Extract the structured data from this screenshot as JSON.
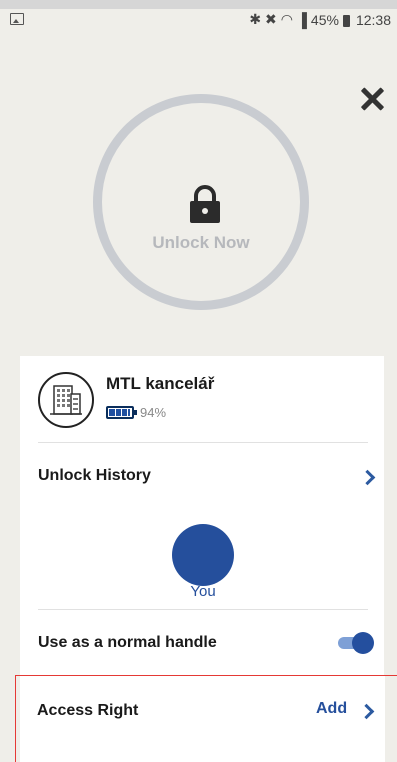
{
  "status_bar": {
    "battery_percent": "45%",
    "time": "12:38",
    "icons": [
      "bluetooth-icon",
      "mute-icon",
      "wifi-icon",
      "signal-icon",
      "battery-icon"
    ]
  },
  "unlock": {
    "label": "Unlock Now"
  },
  "lock_device": {
    "name": "MTL kancelář",
    "battery": "94%",
    "battery_level": 0.94
  },
  "history": {
    "title": "Unlock History",
    "entries": [
      {
        "name": "You"
      }
    ]
  },
  "handle": {
    "label": "Use as a normal handle",
    "enabled": true
  },
  "access": {
    "label": "Access Right",
    "add_label": "Add"
  },
  "colors": {
    "accent": "#254f9c",
    "highlight_border": "#e53935"
  }
}
